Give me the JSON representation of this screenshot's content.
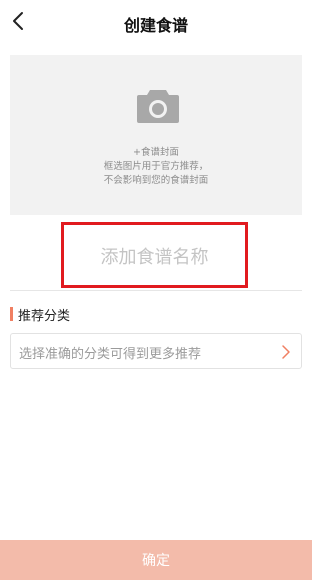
{
  "header": {
    "back_icon": "chevron-left-icon",
    "title": "创建食谱"
  },
  "cover": {
    "icon": "camera-icon",
    "add_label": "+食谱封面",
    "desc_line1": "框选图片用于官方推荐，",
    "desc_line2": "不会影响到您的食谱封面"
  },
  "recipe_name": {
    "value": "",
    "placeholder": "添加食谱名称"
  },
  "category": {
    "section_title": "推荐分类",
    "placeholder": "选择准确的分类可得到更多推荐",
    "icon": "chevron-right-icon"
  },
  "footer": {
    "confirm_label": "确定"
  },
  "colors": {
    "accent": "#f07f62",
    "confirm_bg": "#f3bbaa",
    "highlight_border": "#e11a1f",
    "cover_bg": "#f2f2f2"
  }
}
